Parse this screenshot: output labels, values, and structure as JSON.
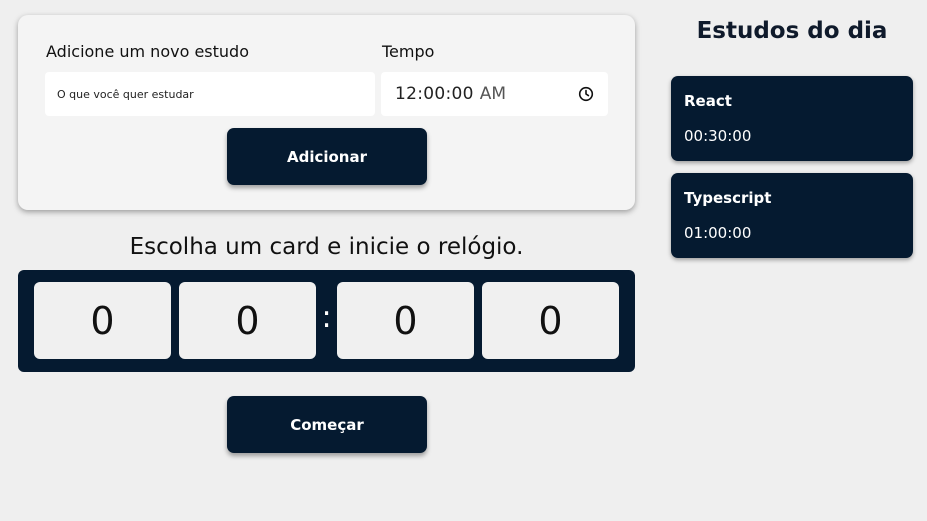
{
  "form": {
    "study_label": "Adicione um novo estudo",
    "study_placeholder": "O que você quer estudar",
    "time_label": "Tempo",
    "time_value": "12:00:00",
    "time_ampm": "AM",
    "add_button": "Adicionar"
  },
  "timer": {
    "instruction": "Escolha um card e inicie o relógio.",
    "digits": [
      "0",
      "0",
      "0",
      "0"
    ],
    "separator": ":",
    "start_button": "Começar"
  },
  "sidebar": {
    "title": "Estudos do dia",
    "items": [
      {
        "name": "React",
        "time": "00:30:00"
      },
      {
        "name": "Typescript",
        "time": "01:00:00"
      }
    ]
  },
  "colors": {
    "background": "#efefef",
    "navy": "#051a30",
    "card": "#f4f4f4"
  }
}
